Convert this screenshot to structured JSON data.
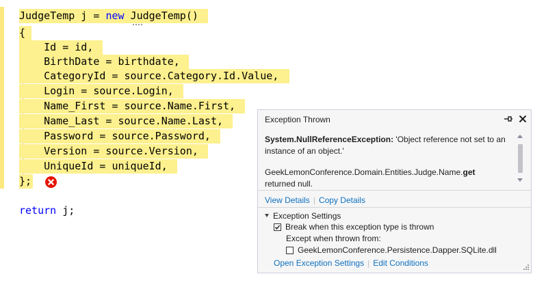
{
  "code": {
    "lines": [
      "JudgeTemp j = new JudgeTemp()",
      "{",
      "    Id = id,",
      "    BirthDate = birthdate,",
      "    CategoryId = source.Category.Id.Value,",
      "    Login = source.Login,",
      "    Name_First = source.Name.First,",
      "    Name_Last = source.Name.Last,",
      "    Password = source.Password,",
      "    Version = source.Version,",
      "    UniqueId = uniqueId,",
      "};",
      "",
      "return j;"
    ],
    "colors": {
      "highlight": "#fdf08e",
      "keyword": "#0000ff",
      "error": "#e51400"
    }
  },
  "exception_popup": {
    "title": "Exception Thrown",
    "exception_type": "System.NullReferenceException:",
    "exception_message": " 'Object reference not set to an instance of an object.'",
    "detail_prefix": "GeekLemonConference.Domain.Entities.Judge.Name.",
    "detail_bold": "get",
    "detail_suffix": " returned null.",
    "view_details": "View Details",
    "copy_details": "Copy Details",
    "settings_title": "Exception Settings",
    "break_when_thrown": {
      "label": "Break when this exception type is thrown",
      "checked": true
    },
    "except_when_thrown_from": "Except when thrown from:",
    "module_exception": {
      "label": "GeekLemonConference.Persistence.Dapper.SQLite.dll",
      "checked": false
    },
    "open_exception_settings": "Open Exception Settings",
    "edit_conditions": "Edit Conditions",
    "link_color": "#0e70c0"
  }
}
